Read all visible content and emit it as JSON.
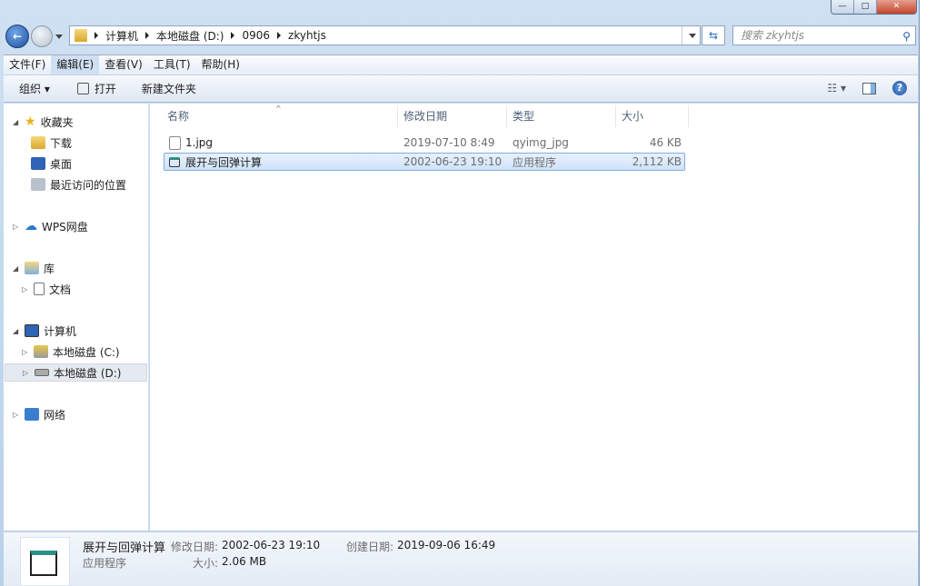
{
  "window": {
    "minimize": "—",
    "maximize": "□",
    "close": "✕"
  },
  "address": {
    "crumbs": [
      "计算机",
      "本地磁盘 (D:)",
      "0906",
      "zkyhtjs"
    ]
  },
  "search": {
    "placeholder": "搜索 zkyhtjs"
  },
  "menu": [
    "文件(F)",
    "编辑(E)",
    "查看(V)",
    "工具(T)",
    "帮助(H)"
  ],
  "toolbar": {
    "organize": "组织 ▾",
    "open": "打开",
    "new_folder": "新建文件夹"
  },
  "sidebar": {
    "favorites": "收藏夹",
    "downloads": "下载",
    "desktop": "桌面",
    "recent": "最近访问的位置",
    "wps": "WPS网盘",
    "library": "库",
    "documents": "文档",
    "computer": "计算机",
    "drive_c": "本地磁盘 (C:)",
    "drive_d": "本地磁盘 (D:)",
    "network": "网络"
  },
  "columns": [
    "名称",
    "修改日期",
    "类型",
    "大小"
  ],
  "files": [
    {
      "name": "1.jpg",
      "date": "2019-07-10 8:49",
      "type": "qyimg_jpg",
      "size": "46 KB"
    },
    {
      "name": "展开与回弹计算",
      "date": "2002-06-23 19:10",
      "type": "应用程序",
      "size": "2,112 KB"
    }
  ],
  "details": {
    "name": "展开与回弹计算",
    "type": "应用程序",
    "modified_label": "修改日期:",
    "modified": "2002-06-23 19:10",
    "created_label": "创建日期:",
    "created": "2019-09-06 16:49",
    "size_label": "大小:",
    "size": "2.06 MB"
  }
}
